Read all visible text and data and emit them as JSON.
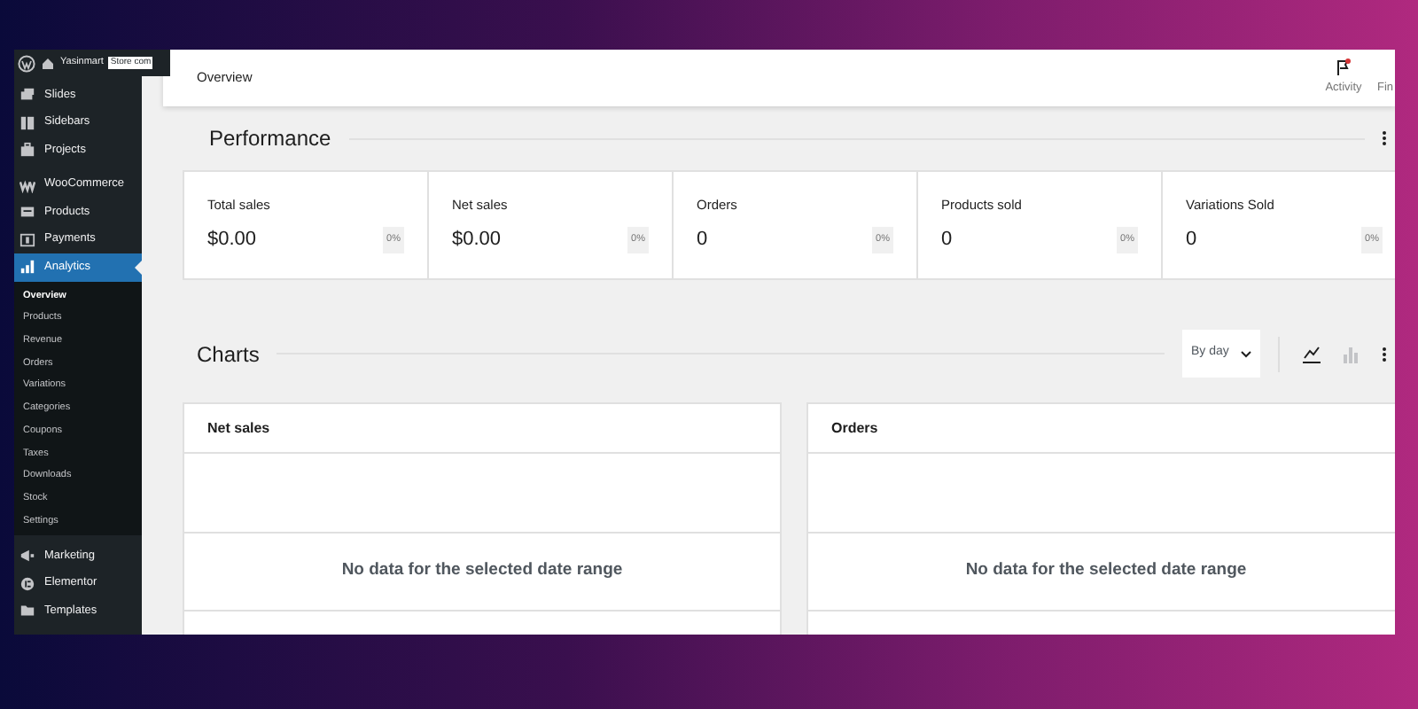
{
  "admin_bar": {
    "site_name": "Yasinmart",
    "field_text": "Store com"
  },
  "sidebar": {
    "items": [
      {
        "label": "Slides",
        "selected": false
      },
      {
        "label": "Sidebars",
        "selected": false
      },
      {
        "label": "Projects",
        "selected": false
      },
      {
        "label": "WooCommerce",
        "selected": false
      },
      {
        "label": "Products",
        "selected": false
      },
      {
        "label": "Payments",
        "selected": false
      },
      {
        "label": "Analytics",
        "selected": true,
        "children": [
          {
            "label": "Overview",
            "selected": true
          },
          {
            "label": "Products",
            "selected": false
          },
          {
            "label": "Revenue",
            "selected": false
          },
          {
            "label": "Orders",
            "selected": false
          },
          {
            "label": "Variations",
            "selected": false
          },
          {
            "label": "Categories",
            "selected": false
          },
          {
            "label": "Coupons",
            "selected": false
          },
          {
            "label": "Taxes",
            "selected": false
          },
          {
            "label": "Downloads",
            "selected": false
          },
          {
            "label": "Stock",
            "selected": false
          },
          {
            "label": "Settings",
            "selected": false
          }
        ]
      },
      {
        "label": "Marketing",
        "selected": false
      },
      {
        "label": "Elementor",
        "selected": false
      },
      {
        "label": "Templates",
        "selected": false
      }
    ]
  },
  "header": {
    "title": "Overview",
    "actions": [
      {
        "label": "Activity"
      },
      {
        "label": "Fin"
      }
    ]
  },
  "performance": {
    "title": "Performance",
    "cards": [
      {
        "label": "Total sales",
        "value": "$0.00",
        "delta": "0%"
      },
      {
        "label": "Net sales",
        "value": "$0.00",
        "delta": "0%"
      },
      {
        "label": "Orders",
        "value": "0",
        "delta": "0%"
      },
      {
        "label": "Products sold",
        "value": "0",
        "delta": "0%"
      },
      {
        "label": "Variations Sold",
        "value": "0",
        "delta": "0%"
      }
    ]
  },
  "charts": {
    "title": "Charts",
    "interval": "By day",
    "toggles": [
      {
        "kind": "line",
        "selected": true
      },
      {
        "kind": "bar",
        "selected": false
      }
    ],
    "panels": [
      {
        "title": "Net sales",
        "message": "No data for the selected date range"
      },
      {
        "title": "Orders",
        "message": "No data for the selected date range"
      }
    ]
  }
}
